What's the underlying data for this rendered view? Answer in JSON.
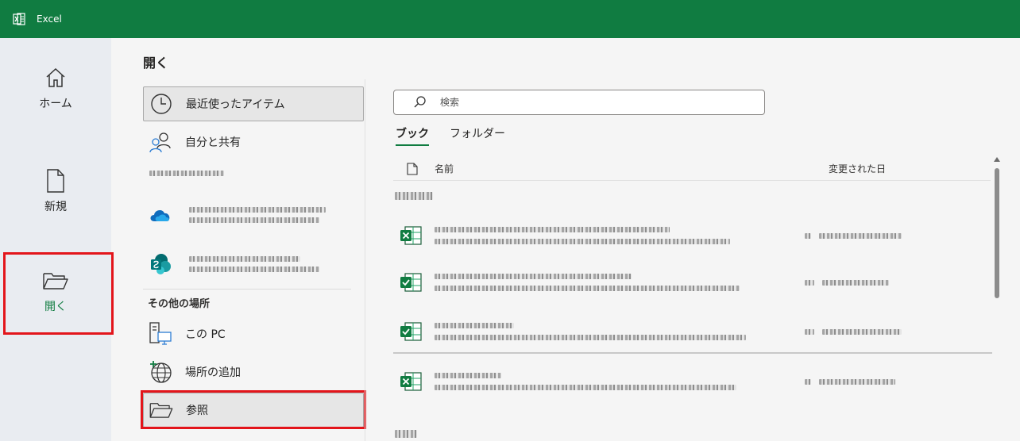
{
  "titlebar": {
    "app_name": "Excel"
  },
  "nav": {
    "home_label": "ホーム",
    "new_label": "新規",
    "open_label": "開く"
  },
  "page": {
    "title": "開く"
  },
  "locations": {
    "recent_label": "最近使ったアイテム",
    "shared_label": "自分と共有",
    "other_places_heading": "その他の場所",
    "this_pc_label": "この PC",
    "add_place_label": "場所の追加",
    "browse_label": "参照"
  },
  "search": {
    "placeholder": "検索"
  },
  "tabs": {
    "books_label": "ブック",
    "folders_label": "フォルダー"
  },
  "list": {
    "col_name": "名前",
    "col_modified": "変更された日"
  },
  "colors": {
    "brand": "#107c41",
    "highlight": "#e3151b"
  }
}
